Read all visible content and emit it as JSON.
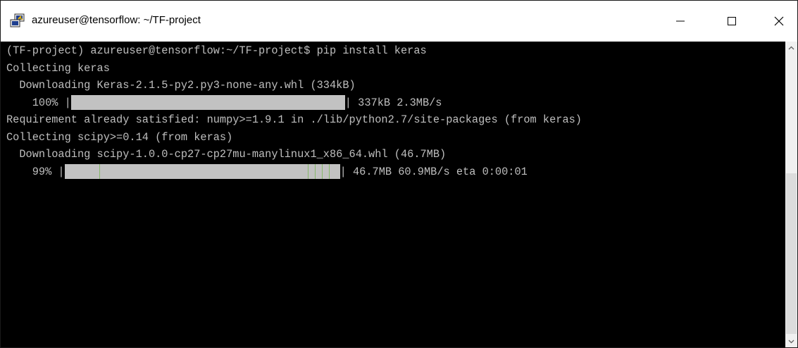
{
  "window": {
    "title": "azureuser@tensorflow: ~/TF-project",
    "icon": "putty-terminal-icon",
    "controls": [
      "minimize-icon",
      "maximize-icon",
      "close-icon"
    ]
  },
  "terminal": {
    "background": "#000000",
    "foreground": "#bfbfbf",
    "lines": [
      "(TF-project) azureuser@tensorflow:~/TF-project$ pip install keras",
      "Collecting keras",
      "  Downloading Keras-2.1.5-py2.py3-none-any.whl (334kB)",
      "Requirement already satisfied: numpy>=1.9.1 in ./lib/python2.7/site-packages (from keras)",
      "Collecting scipy>=0.14 (from keras)",
      "  Downloading scipy-1.0.0-cp27-cp27mu-manylinux1_x86_64.whl (46.7MB)"
    ],
    "progress": [
      {
        "prefix": "    100% |",
        "suffix": "| 337kB 2.3MB/s",
        "percent": 100
      },
      {
        "prefix": "    99% |",
        "suffix": "| 46.7MB 60.9MB/s eta 0:00:01",
        "percent": 99
      }
    ]
  }
}
